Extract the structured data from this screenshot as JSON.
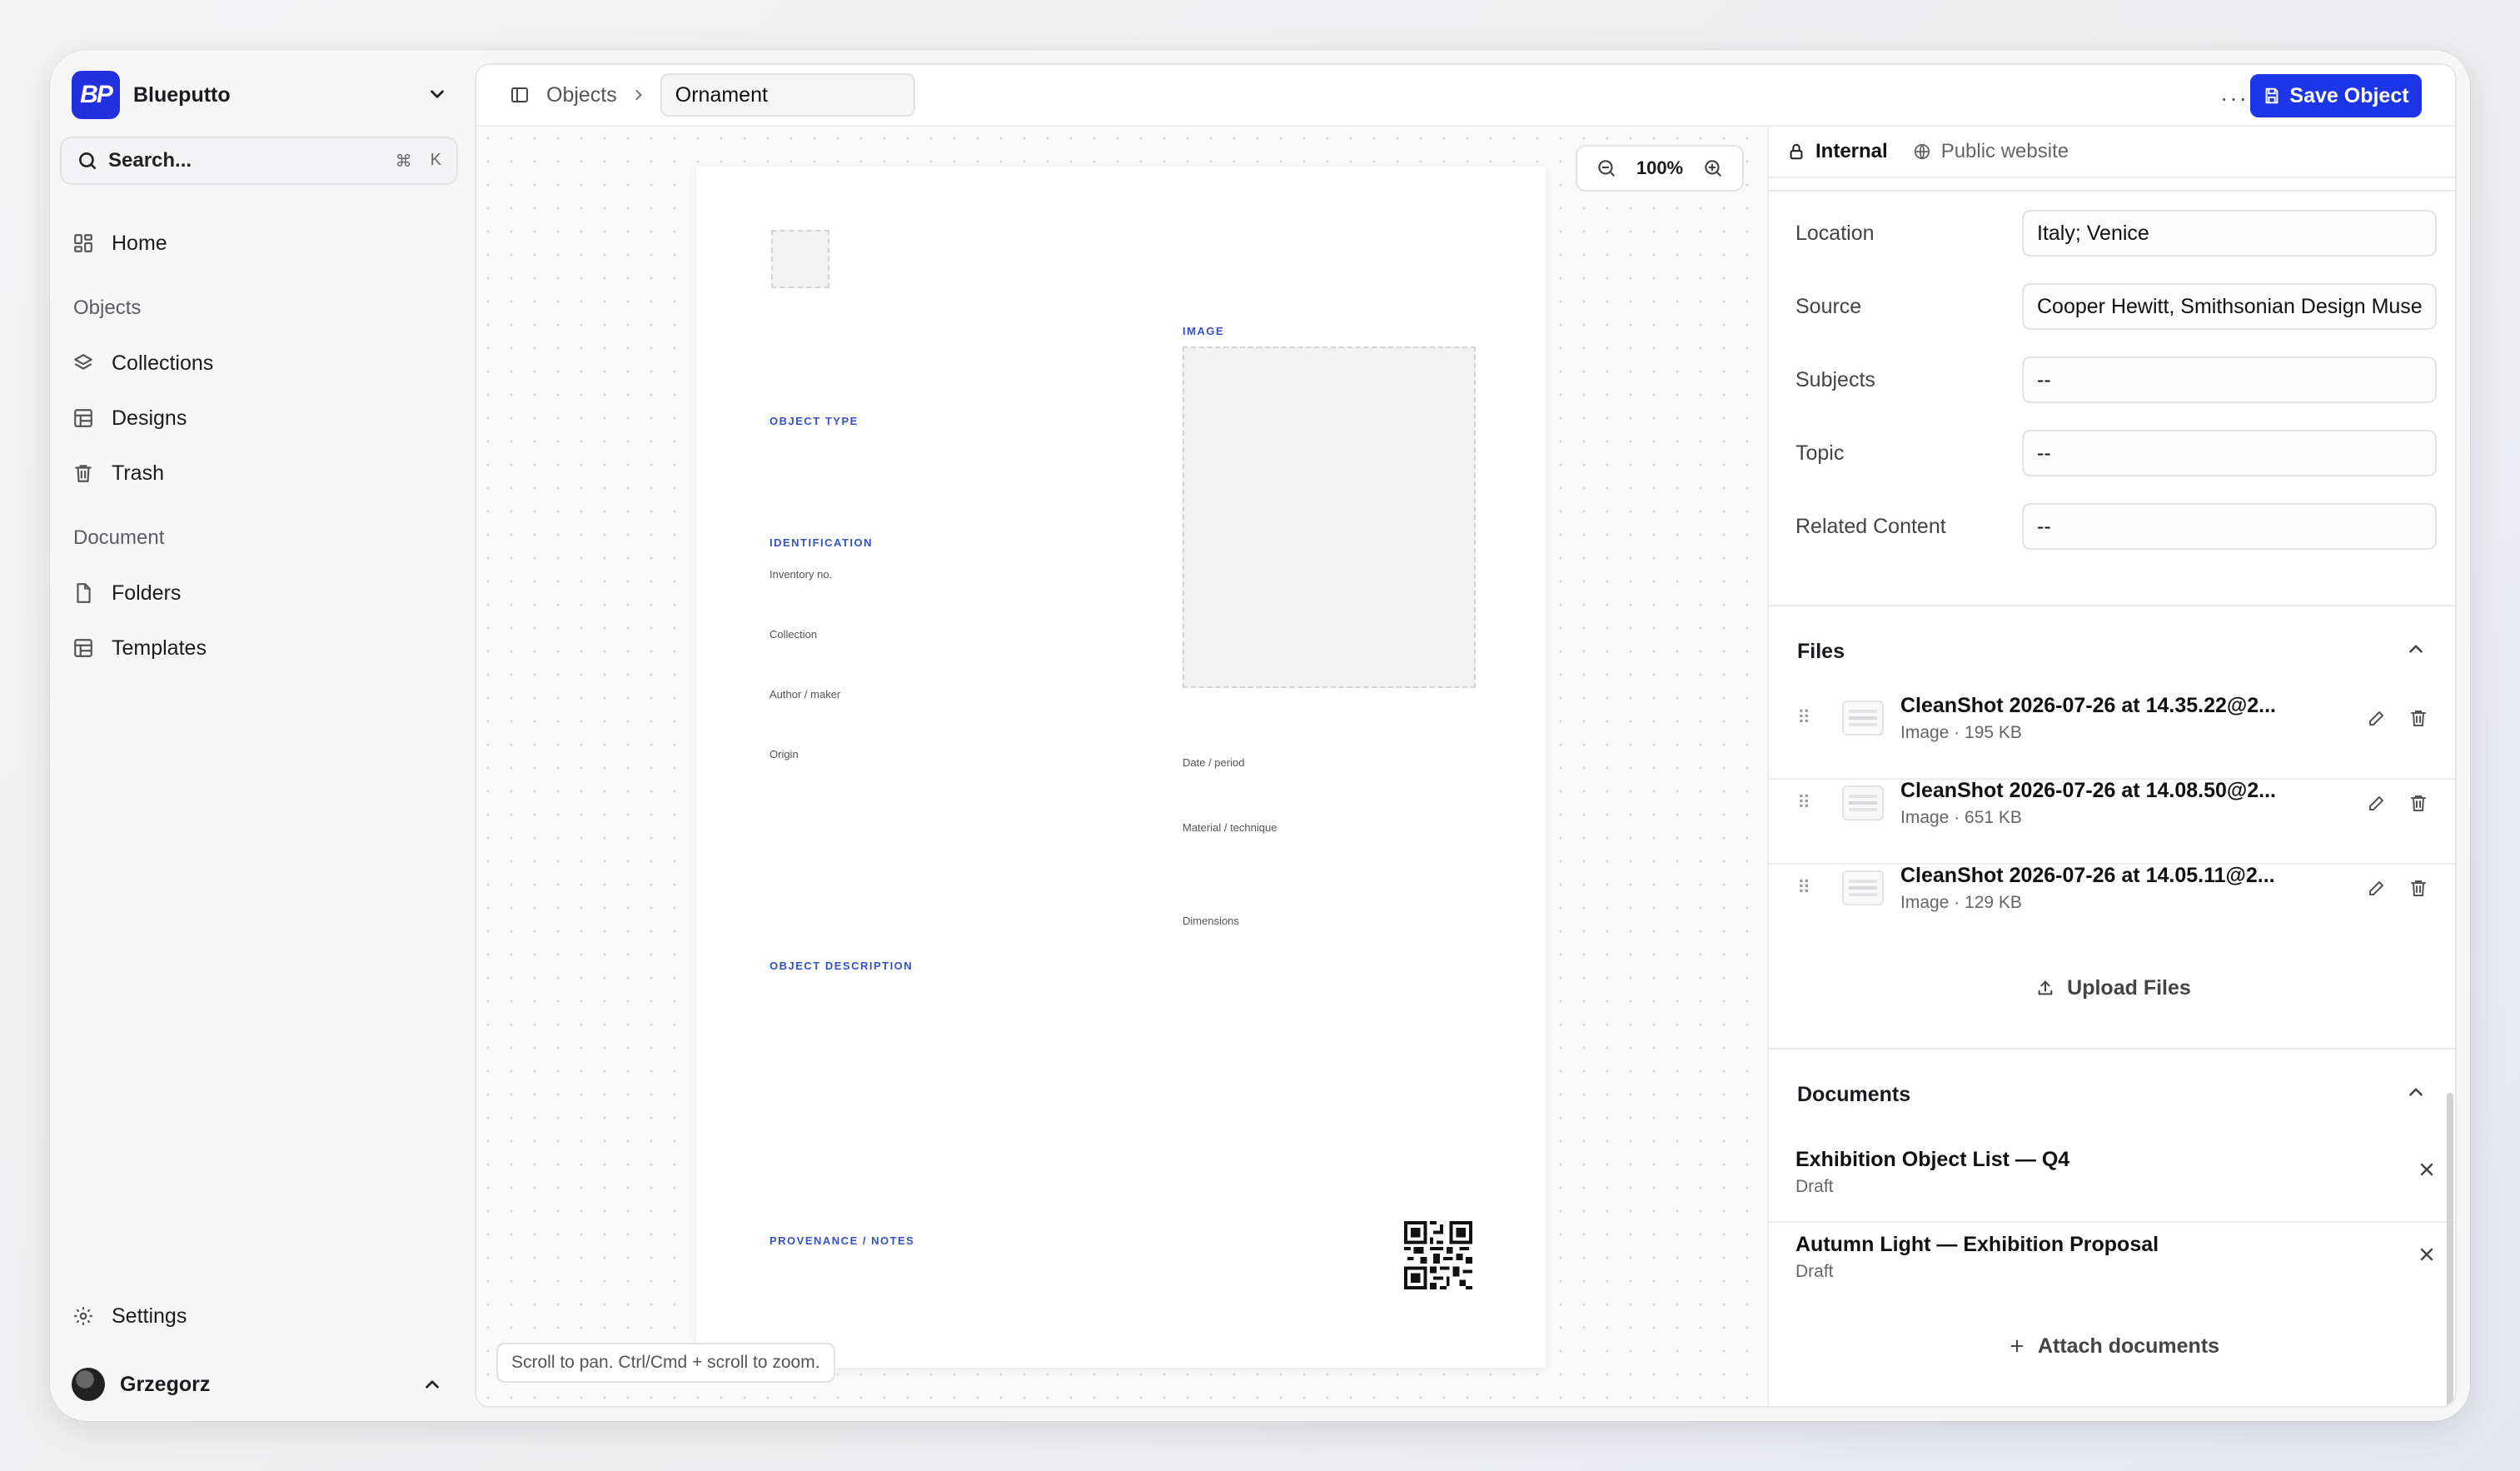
{
  "workspace": {
    "name": "Blueputto",
    "logo_text": "BP"
  },
  "search": {
    "placeholder": "Search...",
    "shortcut_mod": "⌘",
    "shortcut_key": "K"
  },
  "sidebar": {
    "home": "Home",
    "objects_section": "Objects",
    "objects_items": [
      {
        "label": "Collections",
        "icon": "layers-icon"
      },
      {
        "label": "Designs",
        "icon": "layout-icon"
      },
      {
        "label": "Trash",
        "icon": "trash-icon"
      }
    ],
    "document_section": "Document",
    "document_items": [
      {
        "label": "Folders",
        "icon": "file-icon"
      },
      {
        "label": "Templates",
        "icon": "layout-icon"
      }
    ],
    "settings": "Settings",
    "user": "Grzegorz"
  },
  "topbar": {
    "breadcrumb_root": "Objects",
    "object_name": "Ornament",
    "more": "···",
    "save_label": "Save Object"
  },
  "canvas": {
    "zoom_level": "100%",
    "hint": "Scroll to pan. Ctrl/Cmd + scroll to zoom."
  },
  "template": {
    "object_type": "OBJECT TYPE",
    "image": "IMAGE",
    "identification": "IDENTIFICATION",
    "inventory": "Inventory no.",
    "collection": "Collection",
    "author": "Author / maker",
    "origin": "Origin",
    "date": "Date / period",
    "material": "Material / technique",
    "dimensions": "Dimensions",
    "description": "OBJECT DESCRIPTION",
    "provenance": "PROVENANCE / NOTES"
  },
  "panel": {
    "tab_internal": "Internal",
    "tab_public": "Public website",
    "fields": [
      {
        "label": "Location",
        "value": "Italy; Venice"
      },
      {
        "label": "Source",
        "value": "Cooper Hewitt, Smithsonian Design Muse"
      },
      {
        "label": "Subjects",
        "value": "--"
      },
      {
        "label": "Topic",
        "value": "--"
      },
      {
        "label": "Related Content",
        "value": "--"
      }
    ],
    "files_title": "Files",
    "files": [
      {
        "name": "CleanShot 2026-07-26 at 14.35.22@2...",
        "meta": "Image · 195 KB"
      },
      {
        "name": "CleanShot 2026-07-26 at 14.08.50@2...",
        "meta": "Image · 651 KB"
      },
      {
        "name": "CleanShot 2026-07-26 at 14.05.11@2...",
        "meta": "Image · 129 KB"
      }
    ],
    "upload_label": "Upload Files",
    "documents_title": "Documents",
    "documents": [
      {
        "title": "Exhibition Object List — Q4",
        "status": "Draft"
      },
      {
        "title": "Autumn Light — Exhibition Proposal",
        "status": "Draft"
      }
    ],
    "attach_label": "Attach documents"
  },
  "colors": {
    "accent": "#1d35e8",
    "section_label": "#3553c8"
  }
}
